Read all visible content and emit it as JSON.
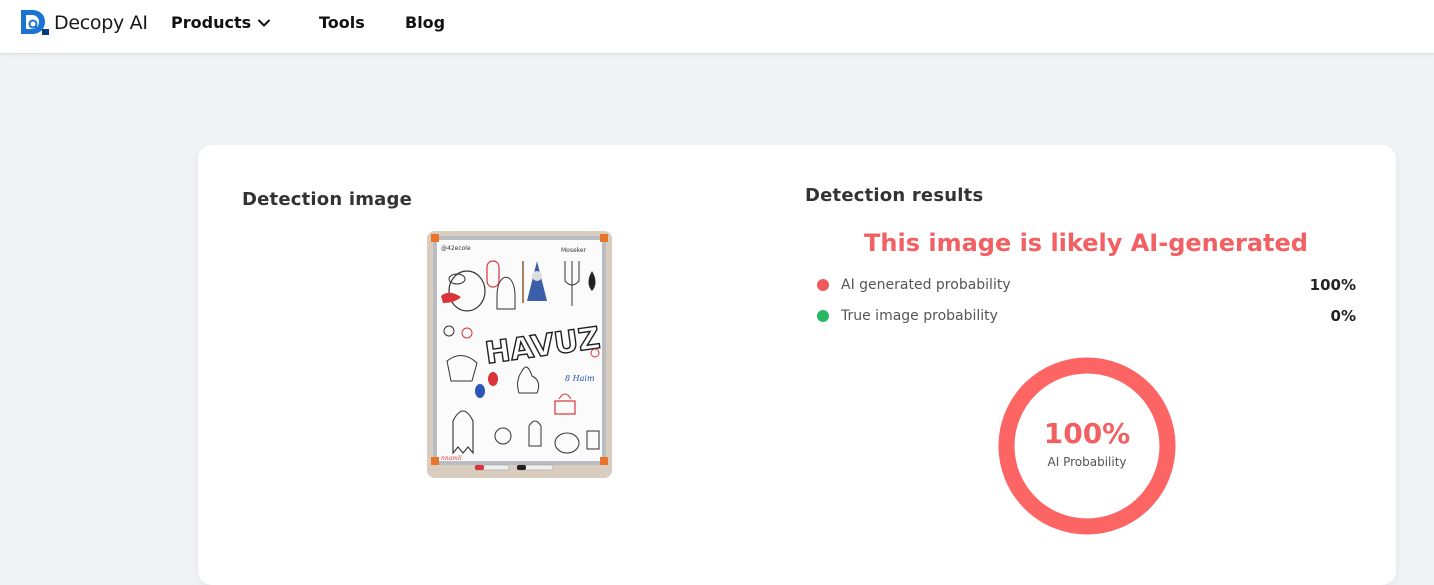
{
  "header": {
    "logo_text": "Decopy AI",
    "nav": {
      "products": "Products",
      "tools": "Tools",
      "blog": "Blog"
    }
  },
  "detection_image": {
    "title": "Detection image",
    "drawing_text": {
      "center": "HAVUZ",
      "top_left": "@42ecole",
      "top_right": "Moseker",
      "signature": "nnamli",
      "side": "8 Haim"
    }
  },
  "results": {
    "title": "Detection results",
    "verdict": "This image is likely AI-generated",
    "rows": [
      {
        "label": "AI generated probability",
        "value": "100%",
        "color": "#ef5a5d"
      },
      {
        "label": "True image probability",
        "value": "0%",
        "color": "#27b864"
      }
    ],
    "gauge": {
      "value_text": "100%",
      "caption": "AI Probability",
      "fraction": 1.0,
      "color": "#fd6565"
    }
  },
  "colors": {
    "accent_red": "#f26063",
    "brand_blue": "#1b74d4",
    "page_bg": "#f1f2f5"
  },
  "icons": {
    "logo": "decopy-logo-icon",
    "products_dropdown": "chevron-down-icon"
  }
}
